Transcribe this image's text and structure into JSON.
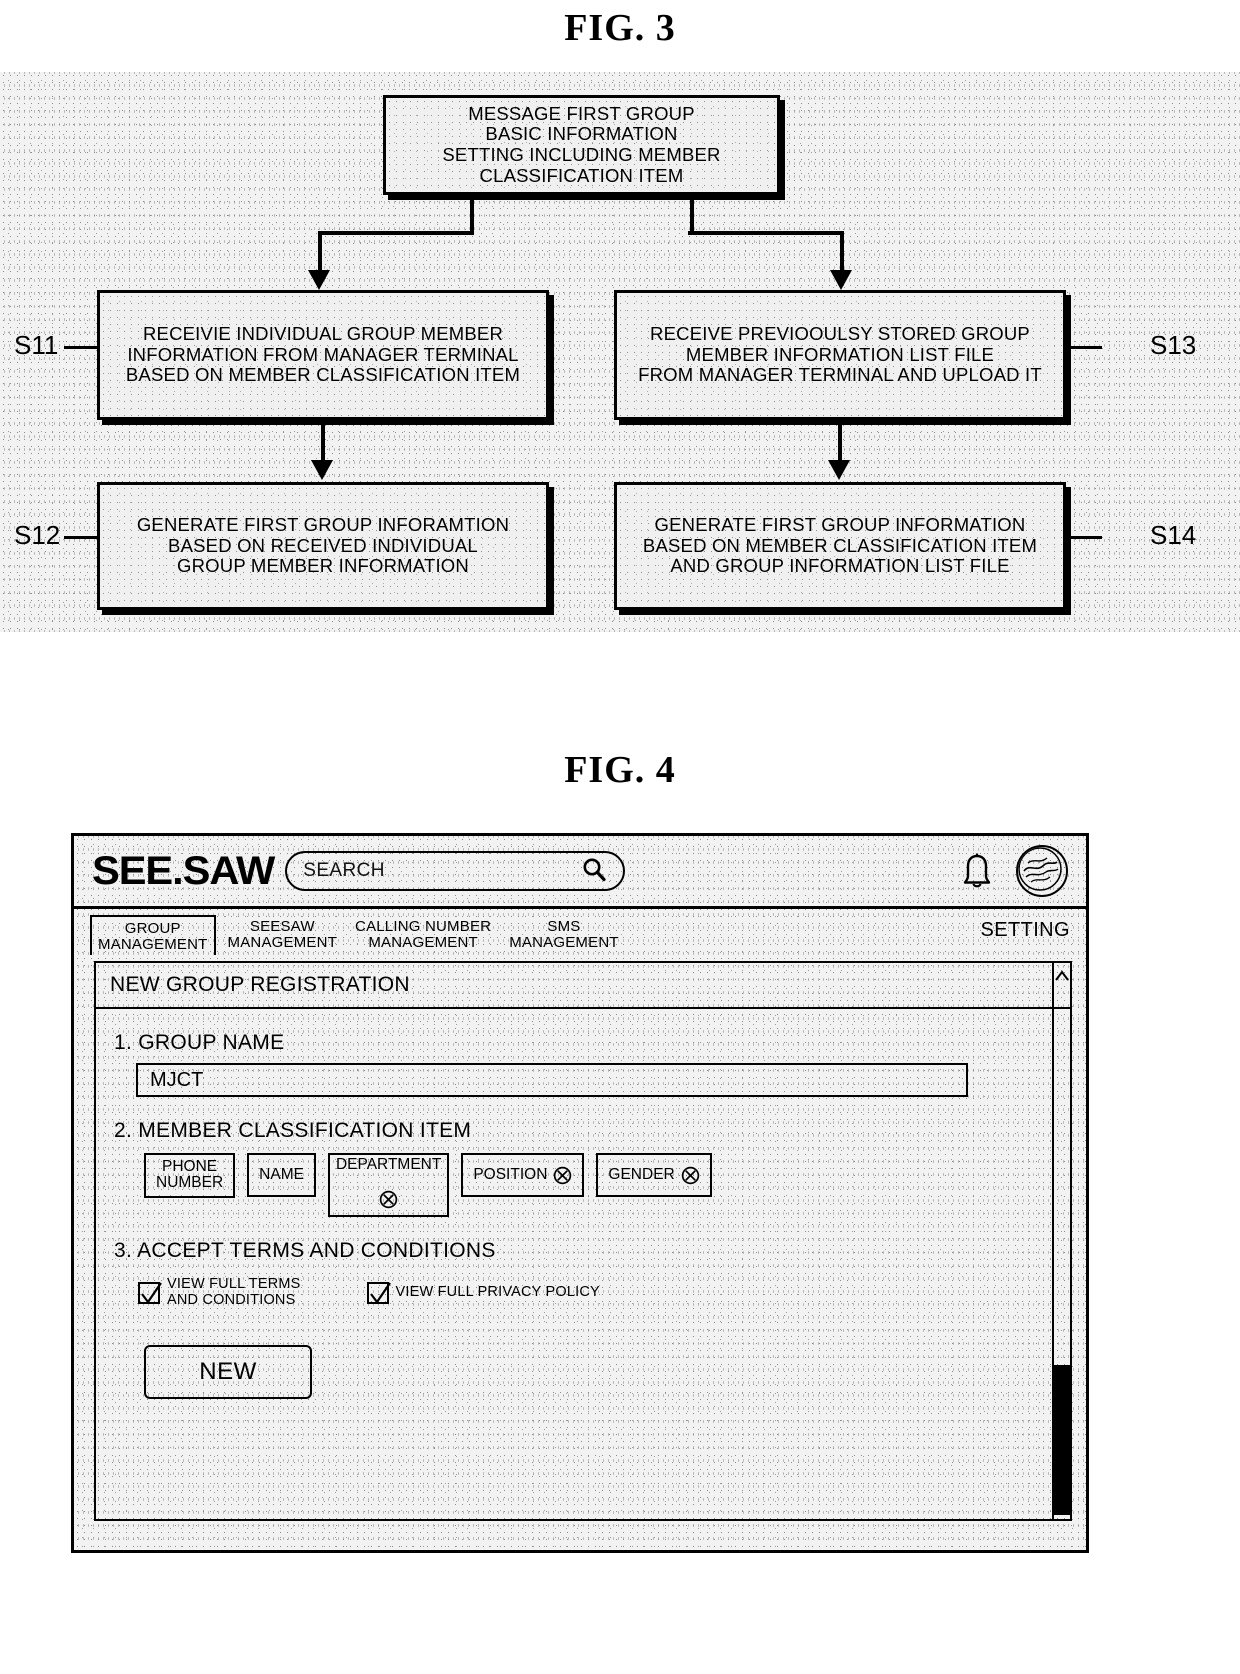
{
  "fig3": {
    "title": "FIG. 3",
    "boxes": {
      "top": [
        "MESSAGE FIRST GROUP",
        "BASIC INFORMATION",
        "SETTING INCLUDING MEMBER",
        "CLASSIFICATION ITEM"
      ],
      "s11": [
        "RECEIVIE INDIVIDUAL GROUP MEMBER",
        "INFORMATION FROM MANAGER TERMINAL",
        "BASED ON MEMBER CLASSIFICATION ITEM"
      ],
      "s13": [
        "RECEIVE PREVIOOULSY STORED GROUP",
        "MEMBER INFORMATION LIST FILE",
        "FROM MANAGER TERMINAL AND UPLOAD IT"
      ],
      "s12": [
        "GENERATE FIRST GROUP INFORAMTION",
        "BASED ON RECEIVED INDIVIDUAL",
        "GROUP MEMBER INFORMATION"
      ],
      "s14": [
        "GENERATE FIRST GROUP INFORMATION",
        "BASED ON MEMBER CLASSIFICATION ITEM",
        "AND GROUP INFORMATION LIST FILE"
      ]
    },
    "labels": {
      "s11": "S11",
      "s12": "S12",
      "s13": "S13",
      "s14": "S14"
    }
  },
  "fig4": {
    "title": "FIG. 4",
    "appbar": {
      "logo": "SEE.SAW",
      "search_placeholder": "SEARCH",
      "search_icon": "search-icon",
      "bell_icon": "bell-icon",
      "avatar_icon": "avatar-icon"
    },
    "tabs": [
      {
        "label": "GROUP\nMANAGEMENT",
        "active": true
      },
      {
        "label": "SEESAW\nMANAGEMENT",
        "active": false
      },
      {
        "label": "CALLING NUMBER\nMANAGEMENT",
        "active": false
      },
      {
        "label": "SMS\nMANAGEMENT",
        "active": false
      }
    ],
    "setting_label": "SETTING",
    "panel": {
      "header": "NEW GROUP REGISTRATION",
      "group_name": {
        "label": "1. GROUP NAME",
        "value": "MJCT"
      },
      "classification": {
        "label": "2. MEMBER CLASSIFICATION ITEM",
        "chips": [
          {
            "label": "PHONE\nNUMBER",
            "removable": false,
            "stacked": false
          },
          {
            "label": "NAME",
            "removable": false,
            "stacked": false
          },
          {
            "label": "DEPARTMENT",
            "removable": true,
            "stacked": true
          },
          {
            "label": "POSITION",
            "removable": true,
            "stacked": false
          },
          {
            "label": "GENDER",
            "removable": true,
            "stacked": false
          }
        ]
      },
      "terms": {
        "label": "3. ACCEPT TERMS AND CONDITIONS",
        "items": [
          {
            "label": "VIEW FULL TERMS\nAND CONDITIONS",
            "checked": true
          },
          {
            "label": "VIEW FULL PRIVACY POLICY",
            "checked": true
          }
        ]
      },
      "new_button": "NEW"
    },
    "scrollbar": {
      "up_arrow_icon": "chevron-up-icon"
    }
  },
  "colors": {
    "ink": "#000000",
    "paper": "#ffffff",
    "noise": "#f0f0f0"
  }
}
